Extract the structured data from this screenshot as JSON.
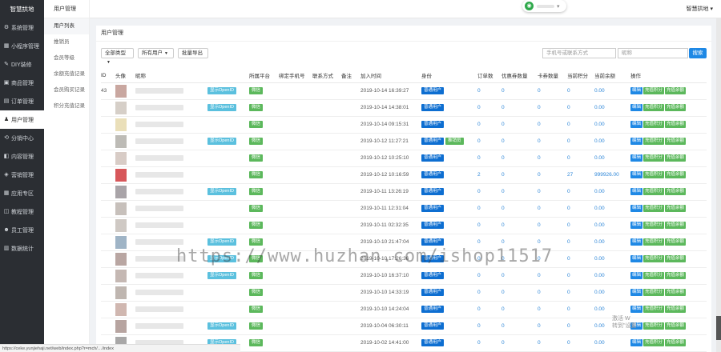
{
  "brand": "智慧拱地",
  "sidebar": [
    {
      "label": "系统管理",
      "icon": "gear-icon",
      "glyph": "⚙"
    },
    {
      "label": "小程序管理",
      "icon": "grid-icon",
      "glyph": "▦"
    },
    {
      "label": "DIY装修",
      "icon": "brush-icon",
      "glyph": "✎"
    },
    {
      "label": "商品管理",
      "icon": "box-icon",
      "glyph": "▣"
    },
    {
      "label": "订单管理",
      "icon": "doc-icon",
      "glyph": "▤"
    },
    {
      "label": "用户管理",
      "icon": "user-icon",
      "glyph": "♟",
      "active": true
    },
    {
      "label": "分销中心",
      "icon": "share-icon",
      "glyph": "⟲"
    },
    {
      "label": "内容管理",
      "icon": "content-icon",
      "glyph": "◧"
    },
    {
      "label": "营销管理",
      "icon": "tag-icon",
      "glyph": "◈"
    },
    {
      "label": "应用专区",
      "icon": "apps-icon",
      "glyph": "▦"
    },
    {
      "label": "教程管理",
      "icon": "book-icon",
      "glyph": "◫"
    },
    {
      "label": "员工管理",
      "icon": "staff-icon",
      "glyph": "☻"
    },
    {
      "label": "数据统计",
      "icon": "chart-icon",
      "glyph": "▥"
    }
  ],
  "subnav": {
    "title": "用户管理",
    "items": [
      "用户列表",
      "推销员",
      "会员等级",
      "余额充值记录",
      "会员购买记录",
      "积分充值记录"
    ]
  },
  "topbar": {
    "user": "智慧拱地"
  },
  "panel_title": "用户管理",
  "toolbar": {
    "filter1": "全部类型",
    "filter2": "所有用户",
    "export": "批量导出",
    "search_placeholder1": "手机号或联系方式",
    "search_placeholder2": "昵称",
    "search_btn": "搜索"
  },
  "columns": [
    "ID",
    "头像",
    "昵称",
    "",
    "所属平台",
    "绑定手机号",
    "联系方式",
    "备注",
    "加入时间",
    "身份",
    "订单数",
    "优惠券数量",
    "卡券数量",
    "当前积分",
    "当前余额",
    "操作"
  ],
  "rows": [
    {
      "id": "43",
      "avatar": "#c9a7a0",
      "time": "2019-10-14 16:39:27",
      "openid": true,
      "seller": false,
      "orders": "0",
      "coupons": "0",
      "cards": "0",
      "points": "0",
      "balance": "0.00"
    },
    {
      "id": "",
      "avatar": "#d6cfc8",
      "time": "2019-10-14 14:38:01",
      "openid": true,
      "seller": false,
      "orders": "0",
      "coupons": "0",
      "cards": "0",
      "points": "0",
      "balance": "0.00"
    },
    {
      "id": "",
      "avatar": "#eadfb9",
      "time": "2019-10-14 09:15:31",
      "openid": false,
      "seller": false,
      "orders": "0",
      "coupons": "0",
      "cards": "0",
      "points": "0",
      "balance": "0.00"
    },
    {
      "id": "",
      "avatar": "#bdbbb6",
      "time": "2019-10-12 11:27:21",
      "openid": true,
      "seller": true,
      "orders": "0",
      "coupons": "0",
      "cards": "0",
      "points": "0",
      "balance": "0.00"
    },
    {
      "id": "",
      "avatar": "#d8ccc6",
      "time": "2019-10-12 10:25:10",
      "openid": false,
      "seller": false,
      "orders": "0",
      "coupons": "0",
      "cards": "0",
      "points": "0",
      "balance": "0.00"
    },
    {
      "id": "",
      "avatar": "#d7575a",
      "time": "2019-10-12 10:16:59",
      "openid": false,
      "seller": false,
      "orders": "2",
      "coupons": "0",
      "cards": "0",
      "points": "27",
      "balance": "999926.00"
    },
    {
      "id": "",
      "avatar": "#a9a4a8",
      "time": "2019-10-11 13:26:19",
      "openid": true,
      "seller": false,
      "orders": "0",
      "coupons": "0",
      "cards": "0",
      "points": "0",
      "balance": "0.00"
    },
    {
      "id": "",
      "avatar": "#c7c0bb",
      "time": "2019-10-11 12:31:04",
      "openid": false,
      "seller": false,
      "orders": "0",
      "coupons": "0",
      "cards": "0",
      "points": "0",
      "balance": "0.00"
    },
    {
      "id": "",
      "avatar": "#cfc9c4",
      "time": "2019-10-11 02:32:35",
      "openid": false,
      "seller": false,
      "orders": "0",
      "coupons": "0",
      "cards": "0",
      "points": "0",
      "balance": "0.00"
    },
    {
      "id": "",
      "avatar": "#9fb4c6",
      "time": "2019-10-10 21:47:04",
      "openid": true,
      "seller": false,
      "orders": "0",
      "coupons": "0",
      "cards": "0",
      "points": "0",
      "balance": "0.00"
    },
    {
      "id": "",
      "avatar": "#b9a6a2",
      "time": "2019-10-10 17:26:36",
      "openid": true,
      "seller": false,
      "orders": "0",
      "coupons": "0",
      "cards": "0",
      "points": "0",
      "balance": "0.00"
    },
    {
      "id": "",
      "avatar": "#c5b8b3",
      "time": "2019-10-10 16:37:10",
      "openid": true,
      "seller": false,
      "orders": "0",
      "coupons": "0",
      "cards": "0",
      "points": "0",
      "balance": "0.00"
    },
    {
      "id": "",
      "avatar": "#bfb6b0",
      "time": "2019-10-10 14:33:19",
      "openid": false,
      "seller": false,
      "orders": "0",
      "coupons": "0",
      "cards": "0",
      "points": "0",
      "balance": "0.00"
    },
    {
      "id": "",
      "avatar": "#d0b7b0",
      "time": "2019-10-10 14:24:04",
      "openid": false,
      "seller": false,
      "orders": "0",
      "coupons": "0",
      "cards": "0",
      "points": "0",
      "balance": "0.00"
    },
    {
      "id": "",
      "avatar": "#b7a4a0",
      "time": "2019-10-04 06:30:11",
      "openid": true,
      "seller": false,
      "orders": "0",
      "coupons": "0",
      "cards": "0",
      "points": "0",
      "balance": "0.00"
    },
    {
      "id": "",
      "avatar": "#a8a7a7",
      "time": "2019-10-02 14:41:00",
      "openid": true,
      "seller": false,
      "orders": "0",
      "coupons": "0",
      "cards": "0",
      "points": "0",
      "balance": "0.00"
    },
    {
      "id": "",
      "avatar": "#c2b9b3",
      "time": "2019-09-25 16:06:49",
      "openid": false,
      "seller": false,
      "orders": "0",
      "coupons": "0",
      "cards": "0",
      "points": "0",
      "balance": "0.00"
    }
  ],
  "labels": {
    "openid": "显示OpenID",
    "platform": "微信",
    "identity": "普通用户",
    "seller": "推销员",
    "edit": "编辑",
    "points": "充值积分",
    "balance": "充值余额"
  },
  "watermark": "https://www.huzhan.com/ishop11517",
  "statusbar": "https://ceke.yunjiehaji.net/web/index.php?r=mch/…/index",
  "activate": [
    "激活 W",
    "转到\"设置"
  ]
}
